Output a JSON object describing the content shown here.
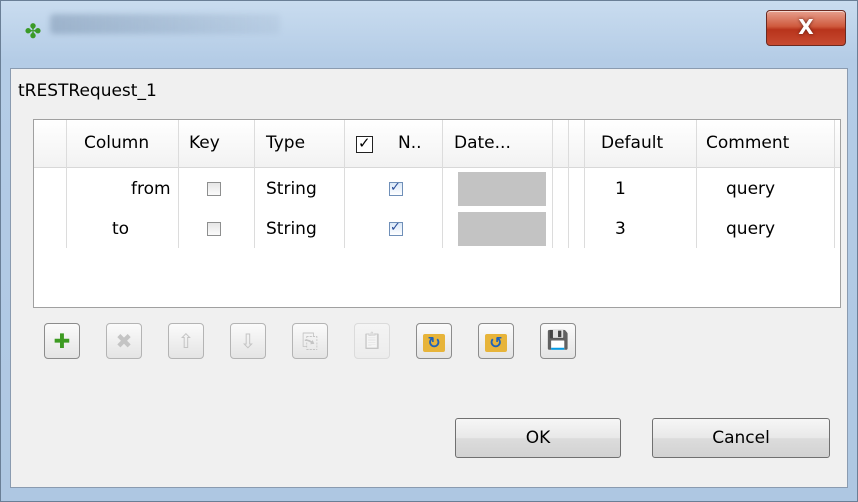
{
  "window": {
    "icon": "schema-plug-icon",
    "close_label": "X"
  },
  "schema": {
    "title": "tRESTRequest_1"
  },
  "table": {
    "headers": {
      "column": "Column",
      "key": "Key",
      "type": "Type",
      "nullable": "N..",
      "date": "Date...",
      "default": "Default",
      "comment": "Comment"
    },
    "rows": [
      {
        "column": "from",
        "key": false,
        "type": "String",
        "nullable": true,
        "default": "1",
        "comment": "query"
      },
      {
        "column": "to",
        "key": false,
        "type": "String",
        "nullable": true,
        "default": "3",
        "comment": "query"
      }
    ]
  },
  "toolbar": {
    "buttons": [
      {
        "icon": "add-icon",
        "glyph": "✚",
        "enabled": true
      },
      {
        "icon": "remove-icon",
        "glyph": "✖",
        "enabled": false
      },
      {
        "icon": "move-up-icon",
        "glyph": "⇧",
        "enabled": false
      },
      {
        "icon": "move-down-icon",
        "glyph": "⇩",
        "enabled": false
      },
      {
        "icon": "copy-icon",
        "glyph": "⎘",
        "enabled": false
      },
      {
        "icon": "paste-icon",
        "glyph": "📋",
        "enabled": false
      },
      {
        "icon": "import-icon",
        "glyph": "↻",
        "enabled": true
      },
      {
        "icon": "export-icon",
        "glyph": "↺",
        "enabled": true
      },
      {
        "icon": "save-icon",
        "glyph": "💾",
        "enabled": true
      }
    ]
  },
  "buttons": {
    "ok": "OK",
    "cancel": "Cancel"
  },
  "colors": {
    "add": "#3d9b22",
    "folder": "#e7b43a",
    "save": "#2c5bb8",
    "disabled": "#c4c4c4"
  }
}
